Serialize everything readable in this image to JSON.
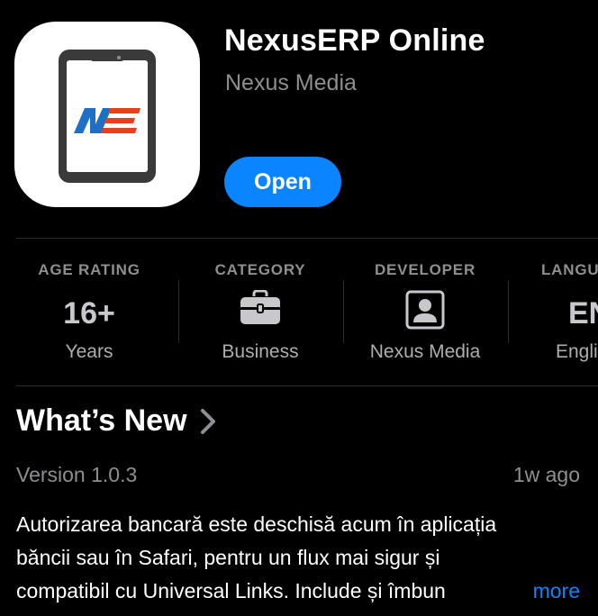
{
  "app": {
    "title": "NexusERP Online",
    "developer": "Nexus Media",
    "open_label": "Open"
  },
  "info": [
    {
      "label": "AGE RATING",
      "value": "16+",
      "sub": "Years"
    },
    {
      "label": "CATEGORY",
      "icon": "briefcase-icon",
      "sub": "Business"
    },
    {
      "label": "DEVELOPER",
      "icon": "person-square-icon",
      "sub": "Nexus Media"
    },
    {
      "label": "LANGU",
      "value": "EN",
      "sub": "Engli"
    }
  ],
  "whats_new": {
    "title": "What’s New",
    "version": "Version 1.0.3",
    "time_ago": "1w ago",
    "notes": [
      "Autorizarea bancară este deschisă acum în aplicația",
      "băncii sau în Safari, pentru un flux mai sigur și",
      "compatibil cu Universal Links. Include și îmbun"
    ],
    "more_label": "more"
  },
  "colors": {
    "accent": "#0a84ff",
    "logo_blue": "#1f6fc6",
    "logo_red": "#e8401c",
    "secondary_text": "#8e8e93"
  }
}
